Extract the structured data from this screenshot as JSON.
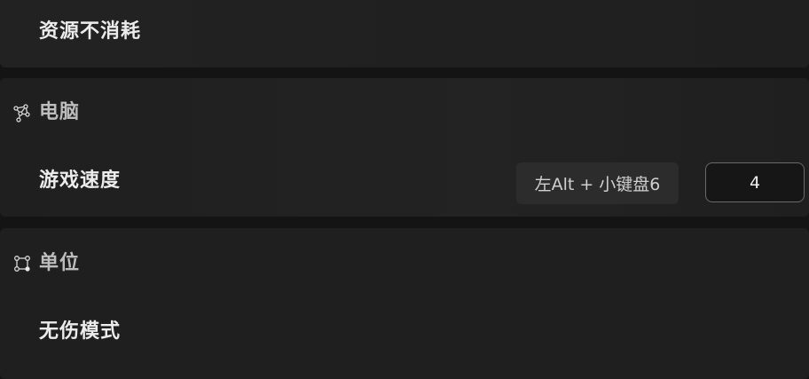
{
  "rows": {
    "infinite_resources": "资源不消耗",
    "game_speed": "游戏速度",
    "invincible_mode": "无伤模式"
  },
  "sections": {
    "computer": {
      "title": "电脑",
      "icon": "network-nodes-icon"
    },
    "unit": {
      "title": "单位",
      "icon": "vector-square-icon"
    }
  },
  "game_speed": {
    "hotkey": "左Alt + 小键盘6",
    "value": "4"
  }
}
